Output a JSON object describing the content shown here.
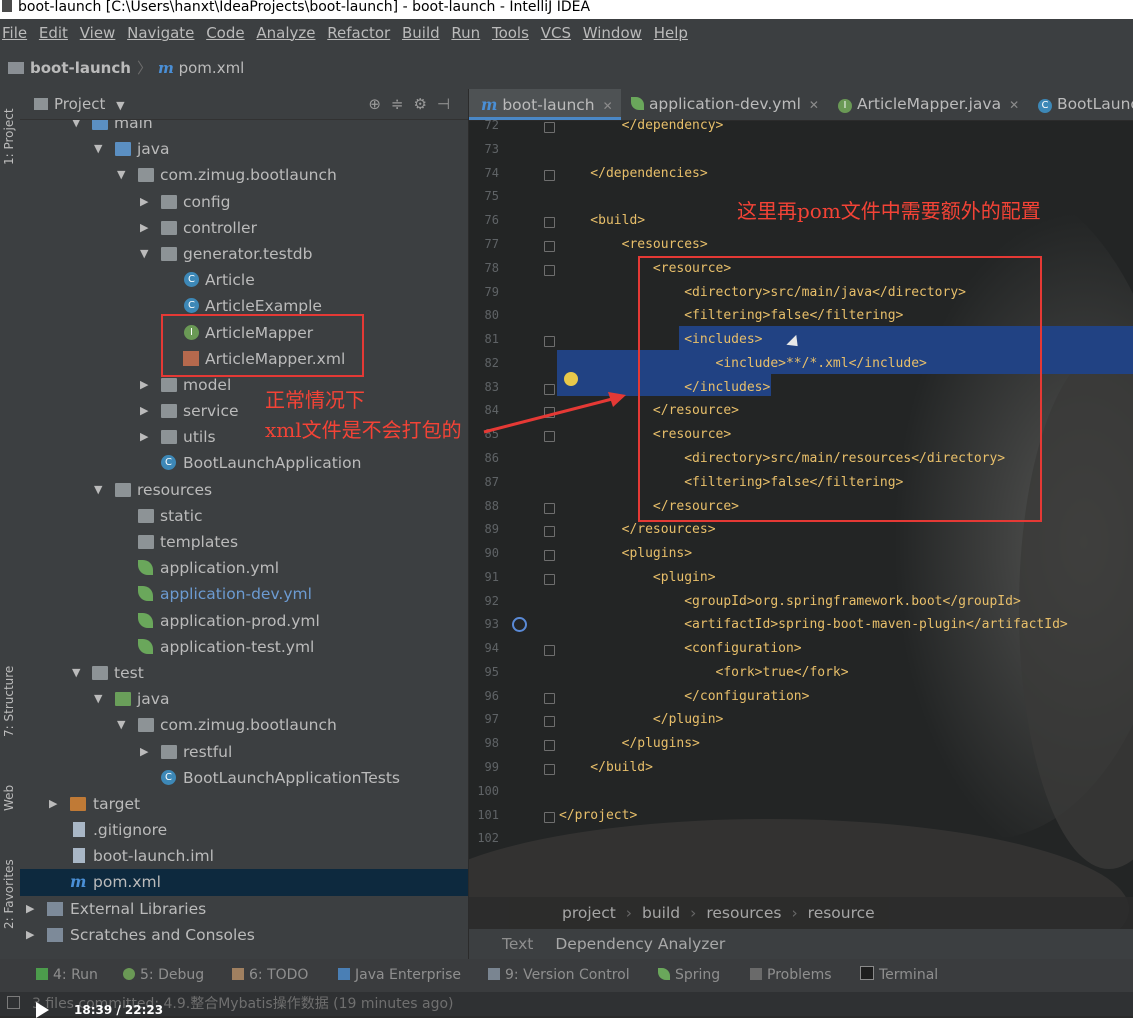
{
  "window": {
    "title": "boot-launch [C:\\Users\\hanxt\\IdeaProjects\\boot-launch] - boot-launch - IntelliJ IDEA"
  },
  "menu": [
    "File",
    "Edit",
    "View",
    "Navigate",
    "Code",
    "Analyze",
    "Refactor",
    "Build",
    "Run",
    "Tools",
    "VCS",
    "Window",
    "Help"
  ],
  "navbar": {
    "project": "boot-launch",
    "file": "pom.xml",
    "file_icon": "m"
  },
  "left_stripe": {
    "tab1": "1: Project",
    "tab2": "7: Structure",
    "tab3": "Web",
    "tab4": "2: Favorites"
  },
  "project_panel": {
    "title": "Project",
    "tree": [
      {
        "label": "main"
      },
      {
        "label": "java"
      },
      {
        "label": "com.zimug.bootlaunch"
      },
      {
        "label": "config"
      },
      {
        "label": "controller"
      },
      {
        "label": "generator.testdb"
      },
      {
        "label": "Article"
      },
      {
        "label": "ArticleExample"
      },
      {
        "label": "ArticleMapper"
      },
      {
        "label": "ArticleMapper.xml"
      },
      {
        "label": "model"
      },
      {
        "label": "service"
      },
      {
        "label": "utils"
      },
      {
        "label": "BootLaunchApplication"
      },
      {
        "label": "resources"
      },
      {
        "label": "static"
      },
      {
        "label": "templates"
      },
      {
        "label": "application.yml"
      },
      {
        "label": "application-dev.yml"
      },
      {
        "label": "application-prod.yml"
      },
      {
        "label": "application-test.yml"
      },
      {
        "label": "test"
      },
      {
        "label": "java"
      },
      {
        "label": "com.zimug.bootlaunch"
      },
      {
        "label": "restful"
      },
      {
        "label": "BootLaunchApplicationTests"
      },
      {
        "label": "target"
      },
      {
        "label": ".gitignore"
      },
      {
        "label": "boot-launch.iml"
      },
      {
        "label": "pom.xml"
      },
      {
        "label": "External Libraries"
      },
      {
        "label": "Scratches and Consoles"
      }
    ]
  },
  "annotations": {
    "left_line1": "正常情况下",
    "left_line2": "xml文件是不会打包的",
    "editor": "这里再pom文件中需要额外的配置"
  },
  "editor": {
    "tabs": [
      {
        "label": "boot-launch"
      },
      {
        "label": "application-dev.yml"
      },
      {
        "label": "ArticleMapper.java"
      },
      {
        "label": "BootLaunchApplication"
      }
    ],
    "line_numbers": [
      "72",
      "73",
      "74",
      "75",
      "76",
      "77",
      "78",
      "79",
      "80",
      "81",
      "82",
      "83",
      "84",
      "85",
      "86",
      "87",
      "88",
      "89",
      "90",
      "91",
      "92",
      "93",
      "94",
      "95",
      "96",
      "97",
      "98",
      "99",
      "100",
      "101",
      "102"
    ],
    "lines": [
      "        </dependency>",
      "",
      "    </dependencies>",
      "",
      "    <build>",
      "        <resources>",
      "            <resource>",
      "                <directory>src/main/java</directory>",
      "                <filtering>false</filtering>",
      "                <includes>",
      "                    <include>**/*.xml</include>",
      "                </includes>",
      "            </resource>",
      "            <resource>",
      "                <directory>src/main/resources</directory>",
      "                <filtering>false</filtering>",
      "            </resource>",
      "        </resources>",
      "        <plugins>",
      "            <plugin>",
      "                <groupId>org.springframework.boot</groupId>",
      "                <artifactId>spring-boot-maven-plugin</artifactId>",
      "                <configuration>",
      "                    <fork>true</fork>",
      "                </configuration>",
      "            </plugin>",
      "        </plugins>",
      "    </build>",
      "",
      "</project>",
      ""
    ],
    "breadcrumb": [
      "project",
      "build",
      "resources",
      "resource"
    ],
    "bottom_tabs": [
      "Text",
      "Dependency Analyzer"
    ]
  },
  "statusbar": {
    "items": [
      "4: Run",
      "5: Debug",
      "6: TODO",
      "Java Enterprise",
      "9: Version Control",
      "Spring",
      "Problems",
      "Terminal"
    ],
    "message": "3 files committed: 4.9.整合Mybatis操作数据 (19 minutes ago)",
    "player_time": "18:39 / 22:23"
  },
  "colors": {
    "tag": "#e8bf6a",
    "text": "#a9b7c6",
    "annotation": "#f44336",
    "selection": "#214283"
  }
}
